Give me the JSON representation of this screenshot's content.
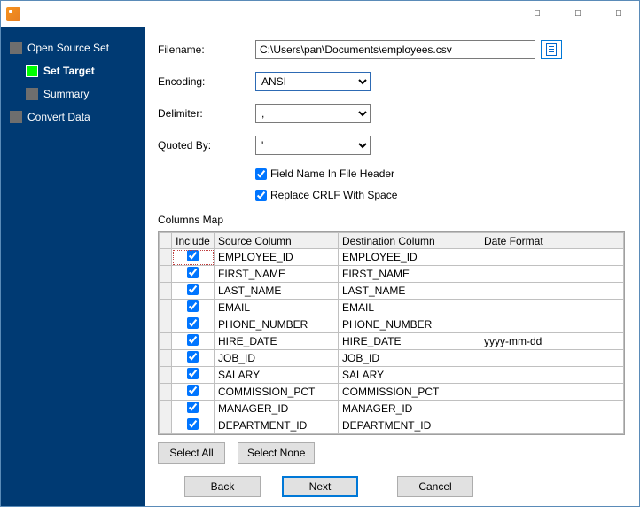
{
  "sidebar": {
    "items": [
      {
        "label": "Open Source Set"
      },
      {
        "label": "Set Target"
      },
      {
        "label": "Summary"
      },
      {
        "label": "Convert Data"
      }
    ]
  },
  "form": {
    "filename_label": "Filename:",
    "filename_value": "C:\\Users\\pan\\Documents\\employees.csv",
    "encoding_label": "Encoding:",
    "encoding_value": "ANSI",
    "delimiter_label": "Delimiter:",
    "delimiter_value": ",",
    "quoted_label": "Quoted By:",
    "quoted_value": "'",
    "check1": "Field Name In File Header",
    "check2": "Replace CRLF With Space",
    "columns_map_label": "Columns Map"
  },
  "grid": {
    "headers": {
      "include": "Include",
      "source": "Source Column",
      "dest": "Destination Column",
      "date": "Date Format"
    },
    "rows": [
      {
        "include": true,
        "source": "EMPLOYEE_ID",
        "dest": "EMPLOYEE_ID",
        "date": ""
      },
      {
        "include": true,
        "source": "FIRST_NAME",
        "dest": "FIRST_NAME",
        "date": ""
      },
      {
        "include": true,
        "source": "LAST_NAME",
        "dest": "LAST_NAME",
        "date": ""
      },
      {
        "include": true,
        "source": "EMAIL",
        "dest": "EMAIL",
        "date": ""
      },
      {
        "include": true,
        "source": "PHONE_NUMBER",
        "dest": "PHONE_NUMBER",
        "date": ""
      },
      {
        "include": true,
        "source": "HIRE_DATE",
        "dest": "HIRE_DATE",
        "date": "yyyy-mm-dd"
      },
      {
        "include": true,
        "source": "JOB_ID",
        "dest": "JOB_ID",
        "date": ""
      },
      {
        "include": true,
        "source": "SALARY",
        "dest": "SALARY",
        "date": ""
      },
      {
        "include": true,
        "source": "COMMISSION_PCT",
        "dest": "COMMISSION_PCT",
        "date": ""
      },
      {
        "include": true,
        "source": "MANAGER_ID",
        "dest": "MANAGER_ID",
        "date": ""
      },
      {
        "include": true,
        "source": "DEPARTMENT_ID",
        "dest": "DEPARTMENT_ID",
        "date": ""
      }
    ]
  },
  "buttons": {
    "select_all": "Select All",
    "select_none": "Select None",
    "back": "Back",
    "next": "Next",
    "cancel": "Cancel"
  }
}
